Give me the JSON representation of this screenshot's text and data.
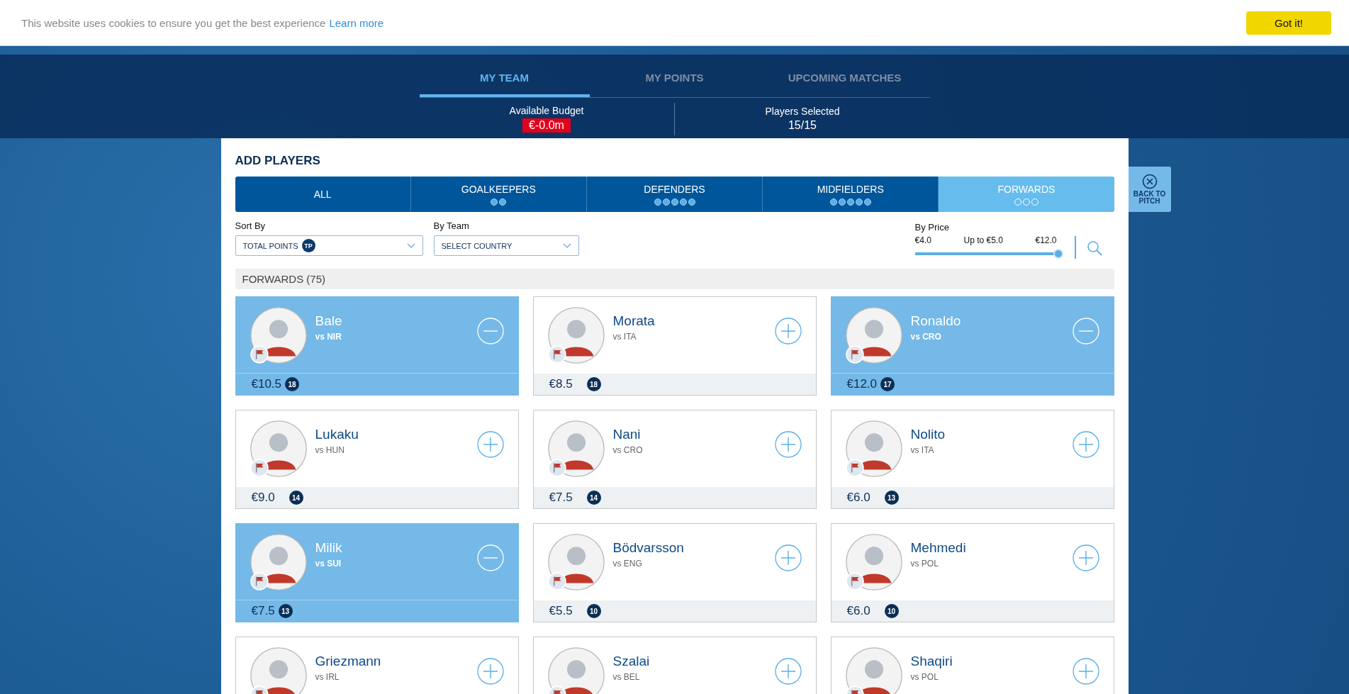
{
  "cookie_bar": {
    "text": "This website uses cookies to ensure you get the best experience",
    "link": "Learn more",
    "button": "Got it!"
  },
  "nav": {
    "tabs": [
      {
        "label": "MY TEAM",
        "selected": true
      },
      {
        "label": "MY POINTS",
        "selected": false
      },
      {
        "label": "UPCOMING MATCHES",
        "selected": false
      }
    ]
  },
  "summary": [
    {
      "label": "Available Budget",
      "value": "€-0.0m",
      "kind": "alert"
    },
    {
      "label": "Players Selected",
      "value": "15/15",
      "kind": "plain"
    }
  ],
  "back_button": {
    "label": "BACK TO PITCH"
  },
  "panel": {
    "title": "ADD PLAYERS",
    "position_tabs": [
      {
        "label": "ALL",
        "selected": false
      },
      {
        "label": "GOALKEEPERS",
        "selected": false,
        "dots": [
          {
            "filled": true
          },
          {
            "filled": true
          }
        ]
      },
      {
        "label": "DEFENDERS",
        "selected": false,
        "dots": [
          {
            "filled": true
          },
          {
            "filled": true
          },
          {
            "filled": true
          },
          {
            "filled": true
          },
          {
            "filled": true
          }
        ]
      },
      {
        "label": "MIDFIELDERS",
        "selected": false,
        "dots": [
          {
            "filled": true
          },
          {
            "filled": true
          },
          {
            "filled": true
          },
          {
            "filled": true
          },
          {
            "filled": true
          }
        ]
      },
      {
        "label": "FORWARDS",
        "selected": true,
        "dots": [
          {
            "filled": false
          },
          {
            "filled": false
          },
          {
            "filled": false
          }
        ]
      }
    ],
    "filters": {
      "sort_by": {
        "label": "Sort By",
        "value": "TOTAL POINTS",
        "badge": "TP"
      },
      "by_team": {
        "label": "By Team",
        "value": "SELECT COUNTRY"
      },
      "by_price": {
        "label": "By Price",
        "min": "€4.0",
        "current": "Up to €5.0",
        "max": "€12.0",
        "level": 1
      }
    },
    "section_header": "FORWARDS (75)",
    "players": [
      {
        "name": "Bale",
        "opponent": "vs NIR",
        "price": "€10.5",
        "points": "18",
        "selected": true
      },
      {
        "name": "Morata",
        "opponent": "vs ITA",
        "price": "€8.5",
        "points": "18",
        "selected": false
      },
      {
        "name": "Ronaldo",
        "opponent": "vs CRO",
        "price": "€12.0",
        "points": "17",
        "selected": true
      },
      {
        "name": "Lukaku",
        "opponent": "vs HUN",
        "price": "€9.0",
        "points": "14",
        "selected": false
      },
      {
        "name": "Nani",
        "opponent": "vs CRO",
        "price": "€7.5",
        "points": "14",
        "selected": false
      },
      {
        "name": "Nolito",
        "opponent": "vs ITA",
        "price": "€6.0",
        "points": "13",
        "selected": false
      },
      {
        "name": "Milik",
        "opponent": "vs SUI",
        "price": "€7.5",
        "points": "13",
        "selected": true
      },
      {
        "name": "Bödvarsson",
        "opponent": "vs ENG",
        "price": "€5.5",
        "points": "10",
        "selected": false
      },
      {
        "name": "Mehmedi",
        "opponent": "vs POL",
        "price": "€6.0",
        "points": "10",
        "selected": false
      },
      {
        "name": "Griezmann",
        "opponent": "vs IRL",
        "selected": false
      },
      {
        "name": "Szalai",
        "opponent": "vs BEL",
        "selected": false
      },
      {
        "name": "Shaqiri",
        "opponent": "vs POL",
        "selected": false
      }
    ]
  }
}
